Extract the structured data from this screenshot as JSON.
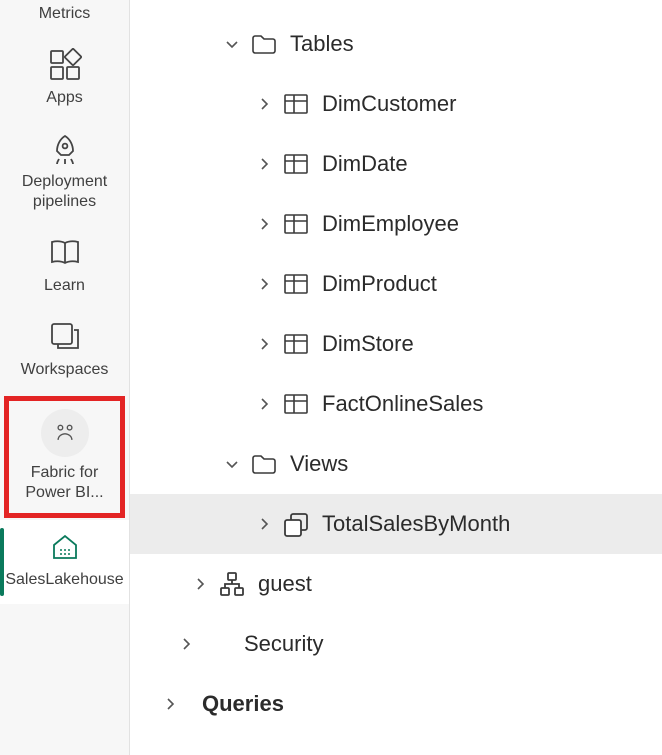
{
  "nav": {
    "metrics": "Metrics",
    "apps": "Apps",
    "pipelines": "Deployment pipelines",
    "learn": "Learn",
    "workspaces": "Workspaces",
    "fabric": "Fabric for Power BI...",
    "lakehouse": "SalesLakehouse"
  },
  "tree": {
    "tables": {
      "label": "Tables",
      "items": [
        "DimCustomer",
        "DimDate",
        "DimEmployee",
        "DimProduct",
        "DimStore",
        "FactOnlineSales"
      ]
    },
    "views": {
      "label": "Views",
      "items": [
        "TotalSalesByMonth"
      ]
    },
    "guest": "guest",
    "security": "Security",
    "queries": "Queries"
  }
}
